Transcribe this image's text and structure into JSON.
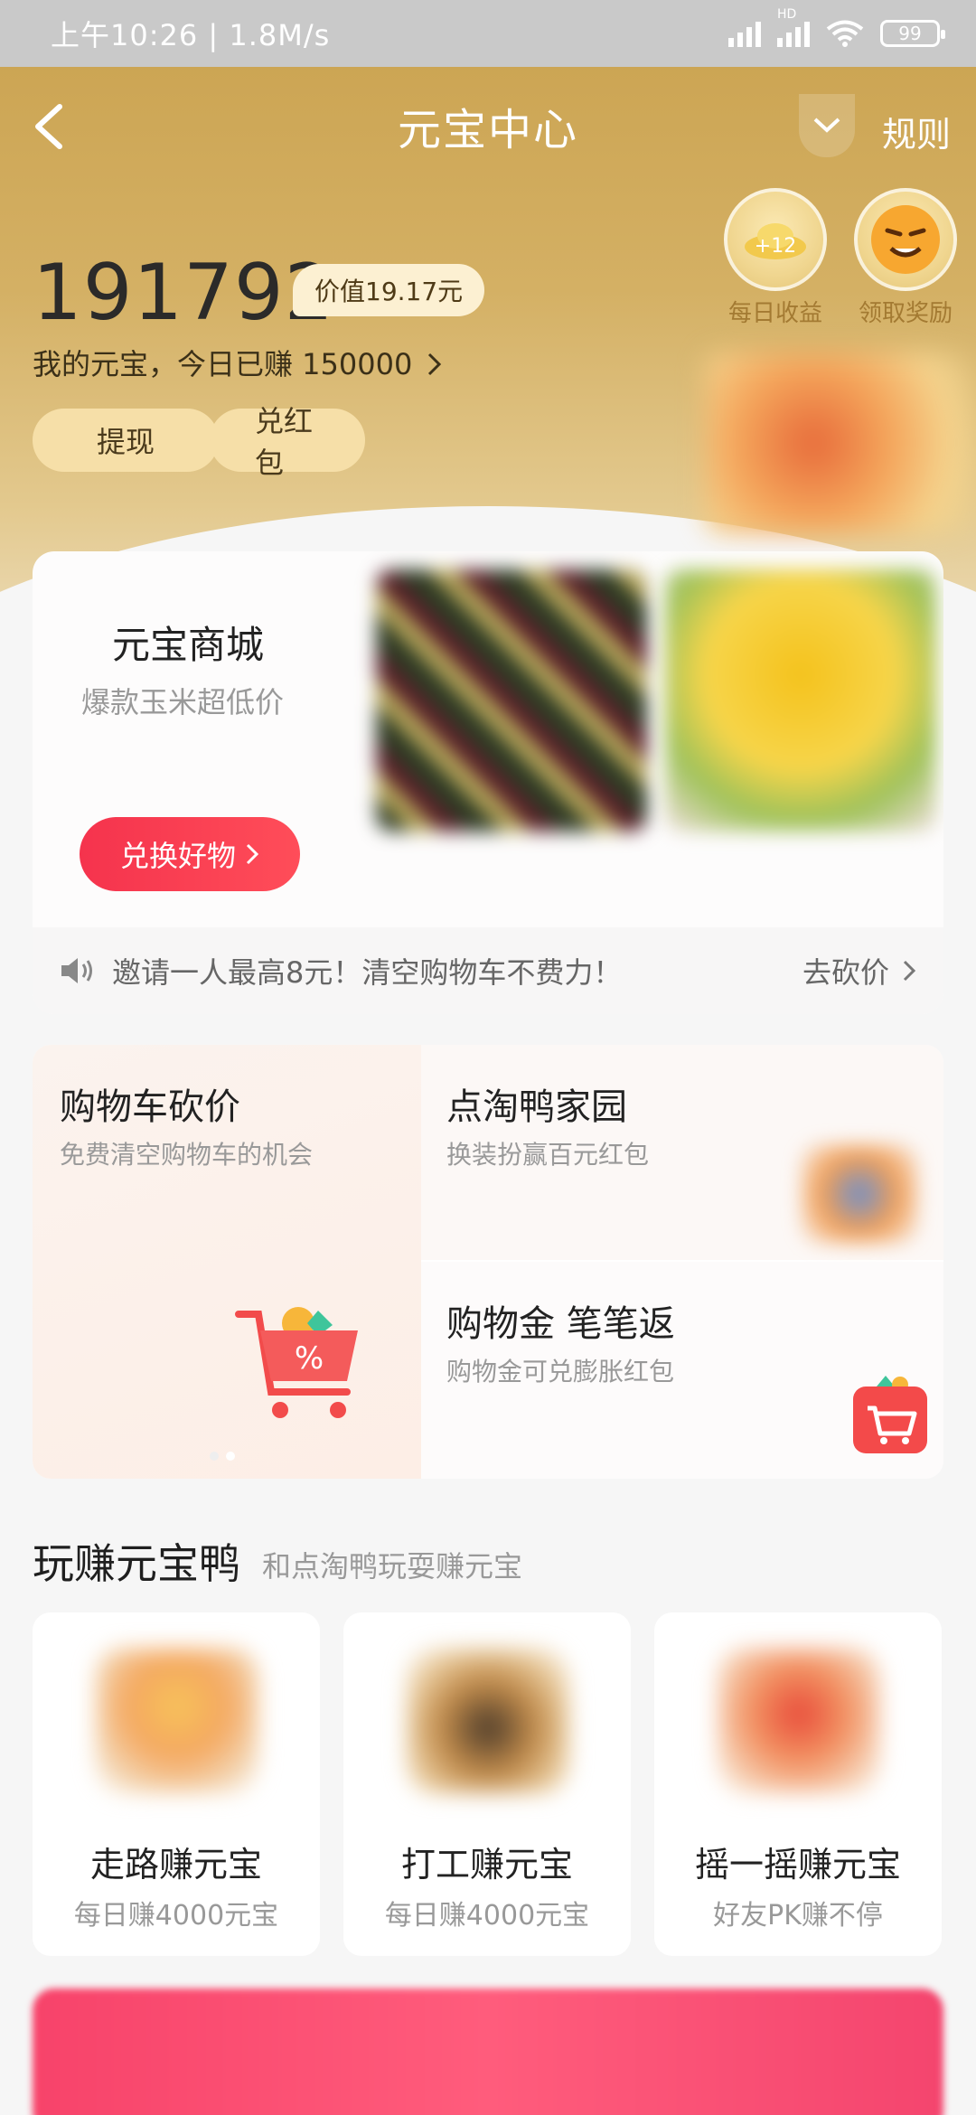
{
  "status_bar": {
    "time_speed": "上午10:26 | 1.8M/s",
    "hd_label": "HD",
    "battery": "99"
  },
  "nav": {
    "title": "元宝中心",
    "rules_label": "规则"
  },
  "top_actions": [
    {
      "label": "每日收益",
      "badge": "+12"
    },
    {
      "label": "领取奖励"
    }
  ],
  "balance": {
    "amount": "191792",
    "value_tag": "价值19.17元",
    "earned_today": "我的元宝，今日已赚 150000"
  },
  "actions": {
    "withdraw": "提现",
    "exchange_red_packet": "兑红包"
  },
  "mall": {
    "title": "元宝商城",
    "subtitle": "爆款玉米超低价",
    "button": "兑换好物",
    "notice": "邀请一人最高8元！清空购物车不费力！",
    "notice_action": "去砍价"
  },
  "features": {
    "cart_bargain": {
      "title": "购物车砍价",
      "subtitle": "免费清空购物车的机会"
    },
    "duck_home": {
      "title": "点淘鸭家园",
      "subtitle": "换装扮赢百元红包"
    },
    "shopping_gold": {
      "title": "购物金 笔笔返",
      "subtitle": "购物金可兑膨胀红包"
    }
  },
  "play_section": {
    "title": "玩赚元宝鸭",
    "subtitle": "和点淘鸭玩耍赚元宝",
    "cards": [
      {
        "title": "走路赚元宝",
        "subtitle": "每日赚4000元宝"
      },
      {
        "title": "打工赚元宝",
        "subtitle": "每日赚4000元宝"
      },
      {
        "title": "摇一摇赚元宝",
        "subtitle": "好友PK赚不停"
      }
    ]
  },
  "colors": {
    "gold_bg": "#caa24f",
    "accent_red": "#f5334d",
    "pill_bg": "#f6dfa8"
  }
}
